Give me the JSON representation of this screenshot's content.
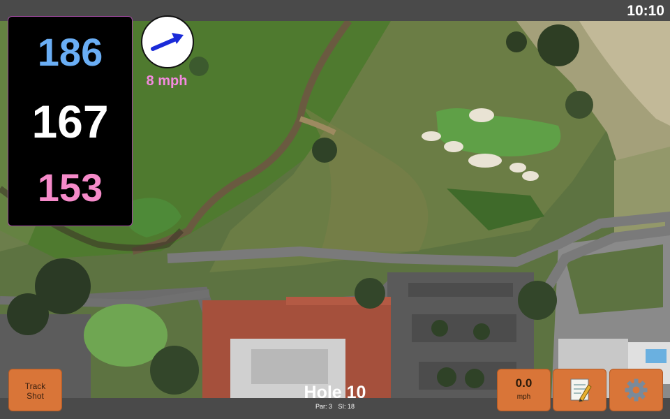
{
  "status": {
    "time": "10:10"
  },
  "distances": {
    "back": "186",
    "middle": "167",
    "front": "153"
  },
  "wind": {
    "speed_text": "8 mph",
    "icon": "wind-arrow-icon"
  },
  "hole": {
    "title": "Hole 10",
    "par": "Par: 3",
    "si": "SI: 18"
  },
  "buttons": {
    "track_line1": "Track",
    "track_line2": "Shot",
    "speed_value": "0.0",
    "speed_unit": "mph",
    "notes_icon": "notes-icon",
    "settings_icon": "gear-icon"
  },
  "colors": {
    "accent": "#d97538",
    "back": "#6aaef5",
    "front": "#f58ac9",
    "wind_text": "#f58ae0"
  }
}
